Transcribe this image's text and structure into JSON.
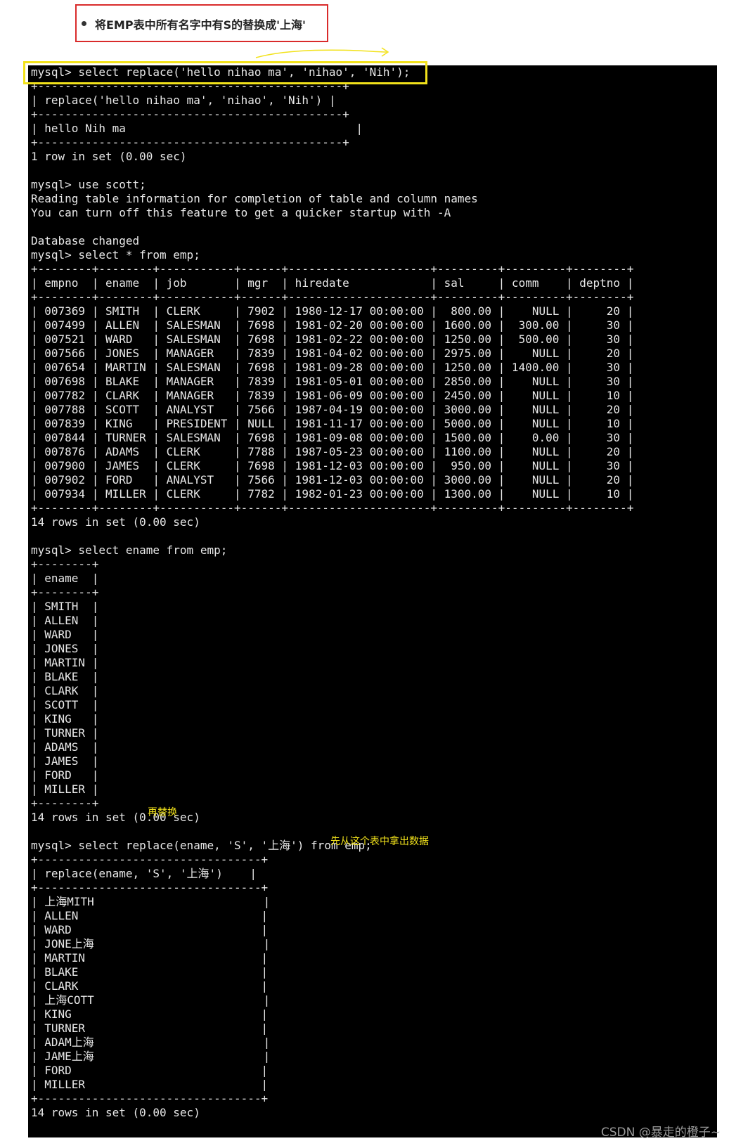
{
  "task": {
    "text": "将EMP表中所有名字中有S的替换成'上海'"
  },
  "colors": {
    "highlight": "#f2e21b",
    "task_border": "#d92b2b",
    "terminal_bg": "#000000",
    "terminal_fg": "#e8e8e8"
  },
  "terminal": {
    "lines": [
      "mysql> select replace('hello nihao ma', 'nihao', 'Nih');",
      "+---------------------------------------------+",
      "| replace('hello nihao ma', 'nihao', 'Nih') |",
      "+---------------------------------------------+",
      "| hello Nih ma                                  |",
      "+---------------------------------------------+",
      "1 row in set (0.00 sec)",
      "",
      "mysql> use scott;",
      "Reading table information for completion of table and column names",
      "You can turn off this feature to get a quicker startup with -A",
      "",
      "Database changed",
      "mysql> select * from emp;",
      "+--------+--------+-----------+------+---------------------+---------+---------+--------+",
      "| empno  | ename  | job       | mgr  | hiredate            | sal     | comm    | deptno |",
      "+--------+--------+-----------+------+---------------------+---------+---------+--------+",
      "| 007369 | SMITH  | CLERK     | 7902 | 1980-12-17 00:00:00 |  800.00 |    NULL |     20 |",
      "| 007499 | ALLEN  | SALESMAN  | 7698 | 1981-02-20 00:00:00 | 1600.00 |  300.00 |     30 |",
      "| 007521 | WARD   | SALESMAN  | 7698 | 1981-02-22 00:00:00 | 1250.00 |  500.00 |     30 |",
      "| 007566 | JONES  | MANAGER   | 7839 | 1981-04-02 00:00:00 | 2975.00 |    NULL |     20 |",
      "| 007654 | MARTIN | SALESMAN  | 7698 | 1981-09-28 00:00:00 | 1250.00 | 1400.00 |     30 |",
      "| 007698 | BLAKE  | MANAGER   | 7839 | 1981-05-01 00:00:00 | 2850.00 |    NULL |     30 |",
      "| 007782 | CLARK  | MANAGER   | 7839 | 1981-06-09 00:00:00 | 2450.00 |    NULL |     10 |",
      "| 007788 | SCOTT  | ANALYST   | 7566 | 1987-04-19 00:00:00 | 3000.00 |    NULL |     20 |",
      "| 007839 | KING   | PRESIDENT | NULL | 1981-11-17 00:00:00 | 5000.00 |    NULL |     10 |",
      "| 007844 | TURNER | SALESMAN  | 7698 | 1981-09-08 00:00:00 | 1500.00 |    0.00 |     30 |",
      "| 007876 | ADAMS  | CLERK     | 7788 | 1987-05-23 00:00:00 | 1100.00 |    NULL |     20 |",
      "| 007900 | JAMES  | CLERK     | 7698 | 1981-12-03 00:00:00 |  950.00 |    NULL |     30 |",
      "| 007902 | FORD   | ANALYST   | 7566 | 1981-12-03 00:00:00 | 3000.00 |    NULL |     20 |",
      "| 007934 | MILLER | CLERK     | 7782 | 1982-01-23 00:00:00 | 1300.00 |    NULL |     10 |",
      "+--------+--------+-----------+------+---------------------+---------+---------+--------+",
      "14 rows in set (0.00 sec)",
      "",
      "mysql> select ename from emp;",
      "+--------+",
      "| ename  |",
      "+--------+",
      "| SMITH  |",
      "| ALLEN  |",
      "| WARD   |",
      "| JONES  |",
      "| MARTIN |",
      "| BLAKE  |",
      "| CLARK  |",
      "| SCOTT  |",
      "| KING   |",
      "| TURNER |",
      "| ADAMS  |",
      "| JAMES  |",
      "| FORD   |",
      "| MILLER |",
      "+--------+",
      "14 rows in set (0.00 sec)",
      "",
      "mysql> select replace(ename, 'S', '上海') from emp;",
      "+---------------------------------+",
      "| replace(ename, 'S', '上海')    |",
      "+---------------------------------+",
      "| 上海MITH                         |",
      "| ALLEN                           |",
      "| WARD                            |",
      "| JONE上海                         |",
      "| MARTIN                          |",
      "| BLAKE                           |",
      "| CLARK                           |",
      "| 上海COTT                         |",
      "| KING                            |",
      "| TURNER                          |",
      "| ADAM上海                         |",
      "| JAME上海                         |",
      "| FORD                            |",
      "| MILLER                          |",
      "+---------------------------------+",
      "14 rows in set (0.00 sec)"
    ]
  },
  "annotations": {
    "replace_note": "再替换",
    "source_note": "先从这个表中拿出数据"
  },
  "watermark": "CSDN @暴走的橙子~"
}
